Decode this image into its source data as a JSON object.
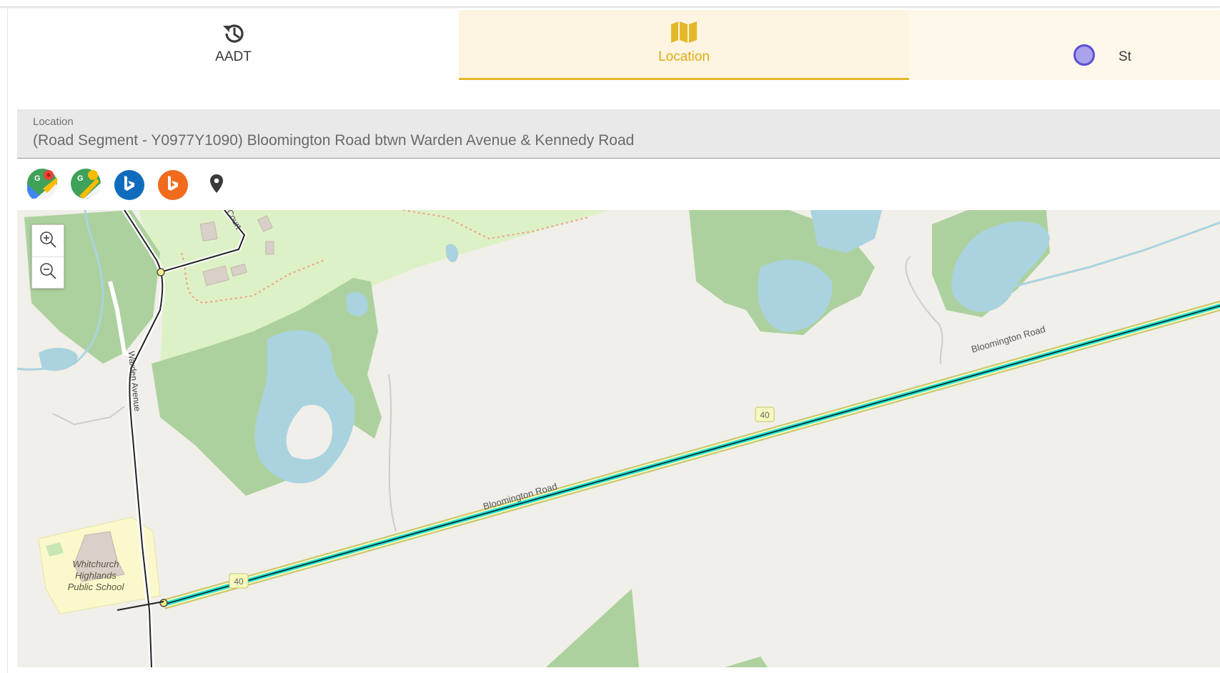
{
  "tabs": [
    {
      "label": "AADT",
      "icon": "history-icon",
      "active": false
    },
    {
      "label": "Location",
      "icon": "map-icon",
      "active": true
    },
    {
      "label": "St",
      "icon": "status-dot-icon",
      "active": false
    }
  ],
  "location_field": {
    "label": "Location",
    "value": "(Road Segment - Y0977Y1090) Bloomington Road btwn Warden Avenue & Kennedy Road"
  },
  "external_links": [
    {
      "icon": "google-maps-icon"
    },
    {
      "icon": "google-street-view-icon"
    },
    {
      "icon": "bing-maps-icon",
      "color": "#0f6cbd"
    },
    {
      "icon": "bing-streetside-icon",
      "color": "#f26b1d"
    },
    {
      "icon": "map-pin-icon"
    }
  ],
  "map": {
    "labels": {
      "bloomington_road_1": "Bloomington Road",
      "bloomington_road_2": "Bloomington Road",
      "warden_avenue": "Warden Avenue",
      "route_shield_1": "40",
      "route_shield_2": "40",
      "school_line1": "Whitchurch",
      "school_line2": "Highlands",
      "school_line3": "Public School",
      "court_label": "Court"
    },
    "colors": {
      "land": "#f1efe9",
      "park": "#ddf1c6",
      "forest": "#add19e",
      "water": "#aad3df",
      "highlight": "#1fe0d5",
      "road_casing": "#c9c46a",
      "school": "#fbf8cc"
    }
  },
  "accent_color": "#e5b82a"
}
